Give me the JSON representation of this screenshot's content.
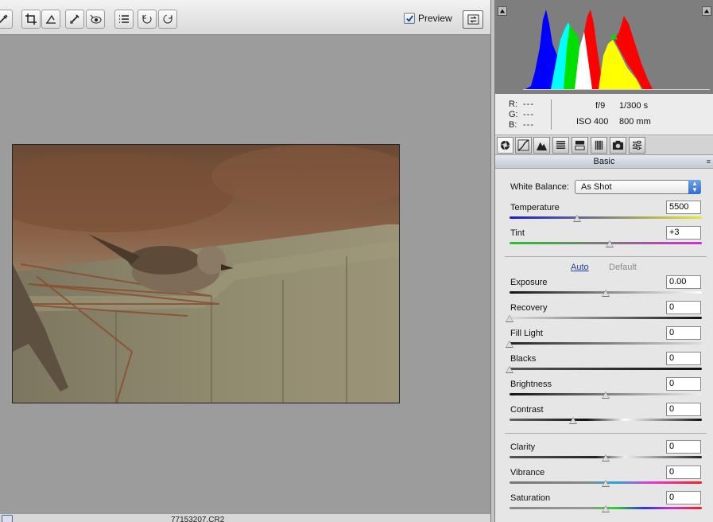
{
  "toolbar": {
    "tools": [
      "white-balance-tool",
      "crop-tool",
      "straighten-tool",
      "spot-removal-tool",
      "red-eye-tool",
      "preferences",
      "rotate-counterclockwise",
      "rotate-clockwise"
    ],
    "preview_label": "Preview",
    "preview_checked": true
  },
  "statusbar": {
    "filename": "77153207.CR2"
  },
  "info": {
    "r_label": "R:",
    "g_label": "G:",
    "b_label": "B:",
    "r_value": "---",
    "g_value": "---",
    "b_value": "---",
    "aperture": "f/9",
    "shutter": "1/300 s",
    "iso": "ISO 400",
    "focal_length": "800 mm"
  },
  "tabs": [
    "basic-icon",
    "tone-curve-icon",
    "detail-icon",
    "hsl-icon",
    "split-toning-icon",
    "lens-corrections-icon",
    "camera-calibration-icon",
    "presets-icon"
  ],
  "panel": {
    "title": "Basic",
    "white_balance_label": "White Balance:",
    "white_balance_value": "As Shot",
    "temperature_label": "Temperature",
    "temperature_value": "5500",
    "tint_label": "Tint",
    "tint_value": "+3",
    "auto_label": "Auto",
    "default_label": "Default",
    "exposure_label": "Exposure",
    "exposure_value": "0.00",
    "recovery_label": "Recovery",
    "recovery_value": "0",
    "fill_light_label": "Fill Light",
    "fill_light_value": "0",
    "blacks_label": "Blacks",
    "blacks_value": "0",
    "brightness_label": "Brightness",
    "brightness_value": "0",
    "contrast_label": "Contrast",
    "contrast_value": "0",
    "clarity_label": "Clarity",
    "clarity_value": "0",
    "vibrance_label": "Vibrance",
    "vibrance_value": "0",
    "saturation_label": "Saturation",
    "saturation_value": "0"
  },
  "slider_levels": {
    "temperature": 0.35,
    "tint": 0.52,
    "exposure": 0.5,
    "recovery": 0.0,
    "fill_light": 0.0,
    "blacks": 0.0,
    "brightness": 0.5,
    "contrast": 0.33,
    "clarity": 0.5,
    "vibrance": 0.5,
    "saturation": 0.5
  },
  "colors": {
    "histogram_blue": "#0000ff",
    "histogram_cyan": "#00ffff",
    "histogram_green": "#00e000",
    "histogram_yellow": "#ffff00",
    "histogram_red": "#ff0000",
    "auto_link": "#1b3fa8"
  }
}
